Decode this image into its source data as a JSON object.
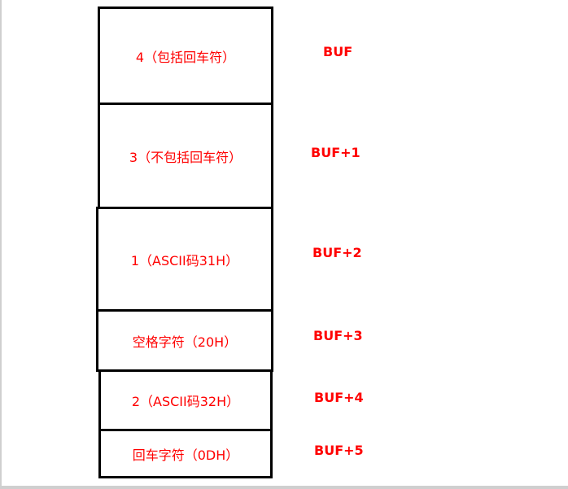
{
  "colors": {
    "text": "#ff0000",
    "border": "#000000"
  },
  "cells": [
    {
      "label": "4（包括回车符）",
      "address": "BUF"
    },
    {
      "label": "3（不包括回车符）",
      "address": "BUF+1"
    },
    {
      "label": "1（ASCII码31H）",
      "address": "BUF+2"
    },
    {
      "label": "空格字符（20H）",
      "address": "BUF+3"
    },
    {
      "label": "2（ASCII码32H）",
      "address": "BUF+4"
    },
    {
      "label": "回车字符（0DH）",
      "address": "BUF+5"
    }
  ]
}
